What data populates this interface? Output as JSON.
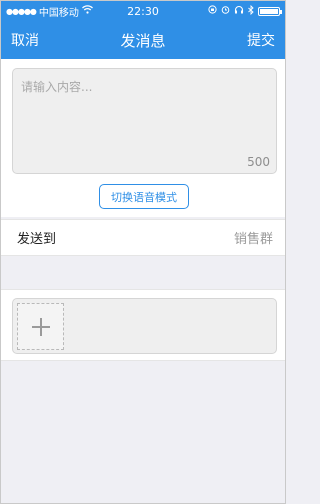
{
  "status": {
    "carrier": "中国移动",
    "time": "22:30"
  },
  "nav": {
    "cancel": "取消",
    "title": "发消息",
    "submit": "提交"
  },
  "editor": {
    "placeholder": "请输入内容...",
    "counter": "500"
  },
  "voice_button": "切换语音模式",
  "send_to": {
    "label": "发送到",
    "value": "销售群"
  }
}
